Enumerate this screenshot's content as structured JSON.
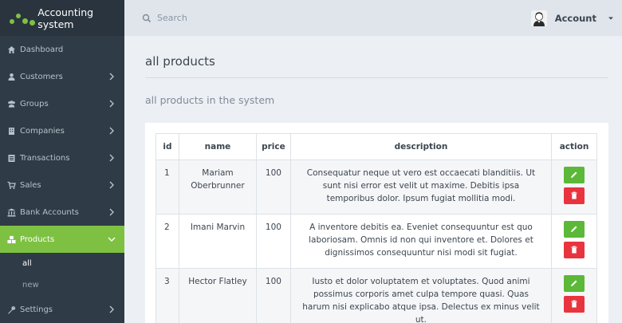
{
  "brand": {
    "title": "Accounting system"
  },
  "search": {
    "placeholder": "Search"
  },
  "account": {
    "label": "Account"
  },
  "sidebar": {
    "items": [
      {
        "label": "Dashboard",
        "icon": "home-icon"
      },
      {
        "label": "Customers",
        "icon": "user-icon"
      },
      {
        "label": "Groups",
        "icon": "users-icon"
      },
      {
        "label": "Companies",
        "icon": "building-icon"
      },
      {
        "label": "Transactions",
        "icon": "list-icon"
      },
      {
        "label": "Sales",
        "icon": "cart-icon"
      },
      {
        "label": "Bank Accounts",
        "icon": "bank-icon"
      },
      {
        "label": "Products",
        "icon": "cubes-icon"
      },
      {
        "label": "Settings",
        "icon": "wrench-icon"
      }
    ],
    "products_sub": [
      {
        "label": "all"
      },
      {
        "label": "new"
      }
    ]
  },
  "page": {
    "title": "all products",
    "subtitle": "all products in the system"
  },
  "table": {
    "headers": [
      "id",
      "name",
      "price",
      "description",
      "action"
    ],
    "rows": [
      {
        "id": "1",
        "name": "Mariam Oberbrunner",
        "price": "100",
        "description": "Consequatur neque ut vero est occaecati blanditiis. Ut sunt nisi error est velit ut maxime. Debitis ipsa temporibus dolor. Ipsum fugiat mollitia modi."
      },
      {
        "id": "2",
        "name": "Imani Marvin",
        "price": "100",
        "description": "A inventore debitis ea. Eveniet consequuntur est quo laboriosam. Omnis id non qui inventore et. Dolores et dignissimos consequuntur nisi modi sit fugiat."
      },
      {
        "id": "3",
        "name": "Hector Flatley",
        "price": "100",
        "description": "Iusto et dolor voluptatem et voluptates. Quod animi possimus corporis amet culpa tempore quasi. Quas harum nisi explicabo atque ipsa. Delectus ex minus velit ut."
      }
    ]
  },
  "colors": {
    "accent": "#7ec142",
    "sidebar": "#2f3b46",
    "edit": "#5cb838",
    "delete": "#e8343f"
  }
}
